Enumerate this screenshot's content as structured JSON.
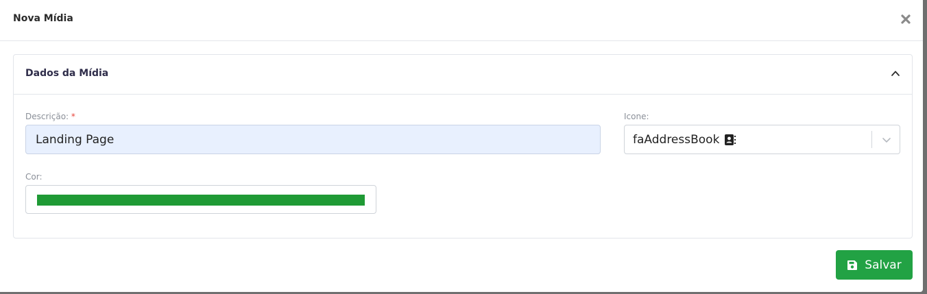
{
  "modal": {
    "title": "Nova Mídia",
    "close_icon": "close-icon"
  },
  "card": {
    "title": "Dados da Mídia",
    "collapse_icon": "chevron-up-icon"
  },
  "form": {
    "descricao": {
      "label": "Descrição:",
      "required_mark": "*",
      "value": "Landing Page"
    },
    "icone": {
      "label": "Icone:",
      "selected_value": "faAddressBook",
      "selected_icon": "address-book-icon",
      "dropdown_icon": "chevron-down-icon"
    },
    "cor": {
      "label": "Cor:",
      "color": "#1f9a35"
    }
  },
  "footer": {
    "save_label": "Salvar",
    "save_icon": "floppy-disk-icon"
  },
  "colors": {
    "accent_green": "#22a244",
    "input_autofill_bg": "#e8f0fe",
    "title_color": "#2f2d4a",
    "required_color": "#e8453c"
  }
}
